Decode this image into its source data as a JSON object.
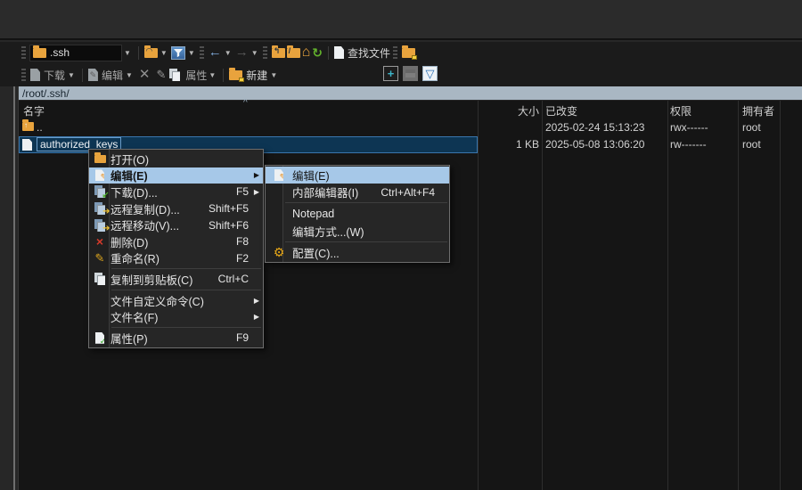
{
  "address_bar": {
    "path": "/root/.ssh/"
  },
  "toolbar1": {
    "location_value": ".ssh",
    "find_files_label": "查找文件"
  },
  "toolbar2": {
    "download_label": "下载",
    "edit_label": "编辑",
    "properties_label": "属性",
    "new_label": "新建"
  },
  "file_panel": {
    "sort_icon": "^",
    "columns": [
      {
        "label": "名字"
      },
      {
        "label": "大小"
      },
      {
        "label": "已改变"
      },
      {
        "label": "权限"
      },
      {
        "label": "拥有者"
      }
    ],
    "rows": [
      {
        "name": "..",
        "size": "",
        "changed": "2025-02-24 15:13:23",
        "perms": "rwx------",
        "owner": "root",
        "icon": "parent-folder",
        "selected": false
      },
      {
        "name": "authorized_keys",
        "size": "1 KB",
        "changed": "2025-05-08 13:06:20",
        "perms": "rw-------",
        "owner": "root",
        "icon": "file",
        "selected": true
      }
    ]
  },
  "context_menu": {
    "items": [
      {
        "label": "打开(O)",
        "shortcut": "",
        "icon": "open-folder"
      },
      {
        "label": "编辑(E)",
        "shortcut": "",
        "icon": "edit-pencil",
        "submenu": true,
        "highlighted": true
      },
      {
        "label": "下载(D)...",
        "shortcut": "F5",
        "icon": "download",
        "submenu": true
      },
      {
        "label": "远程复制(D)...",
        "shortcut": "Shift+F5",
        "icon": "remote-copy"
      },
      {
        "label": "远程移动(V)...",
        "shortcut": "Shift+F6",
        "icon": "remote-move"
      },
      {
        "label": "删除(D)",
        "shortcut": "F8",
        "icon": "delete-x"
      },
      {
        "label": "重命名(R)",
        "shortcut": "F2",
        "icon": "rename-pencil"
      },
      {
        "type": "separator"
      },
      {
        "label": "复制到剪贴板(C)",
        "shortcut": "Ctrl+C",
        "icon": "copy"
      },
      {
        "type": "separator"
      },
      {
        "label": "文件自定义命令(C)",
        "shortcut": "",
        "submenu": true
      },
      {
        "label": "文件名(F)",
        "shortcut": "",
        "submenu": true
      },
      {
        "type": "separator"
      },
      {
        "label": "属性(P)",
        "shortcut": "F9",
        "icon": "properties"
      }
    ]
  },
  "edit_submenu": {
    "items": [
      {
        "label": "编辑(E)",
        "shortcut": "",
        "icon": "edit-pencil",
        "highlighted": true
      },
      {
        "label": "内部编辑器(I)",
        "shortcut": "Ctrl+Alt+F4"
      },
      {
        "type": "separator"
      },
      {
        "label": "Notepad",
        "shortcut": ""
      },
      {
        "label": "编辑方式...(W)",
        "shortcut": ""
      },
      {
        "type": "separator"
      },
      {
        "label": "配置(C)...",
        "shortcut": "",
        "icon": "gear"
      }
    ]
  },
  "colors": {
    "menu_highlight": "#a6c8e8",
    "selection_bg": "#0d3553",
    "selection_border": "#3a76ad",
    "path_bar_bg": "#a9b7c3",
    "folder_orange": "#e8a33d",
    "toolbar_bg": "#1b1b1b",
    "list_bg": "#151515",
    "menu_bg": "#262626",
    "delete_red": "#d43a2a",
    "refresh_green": "#63b32c"
  }
}
